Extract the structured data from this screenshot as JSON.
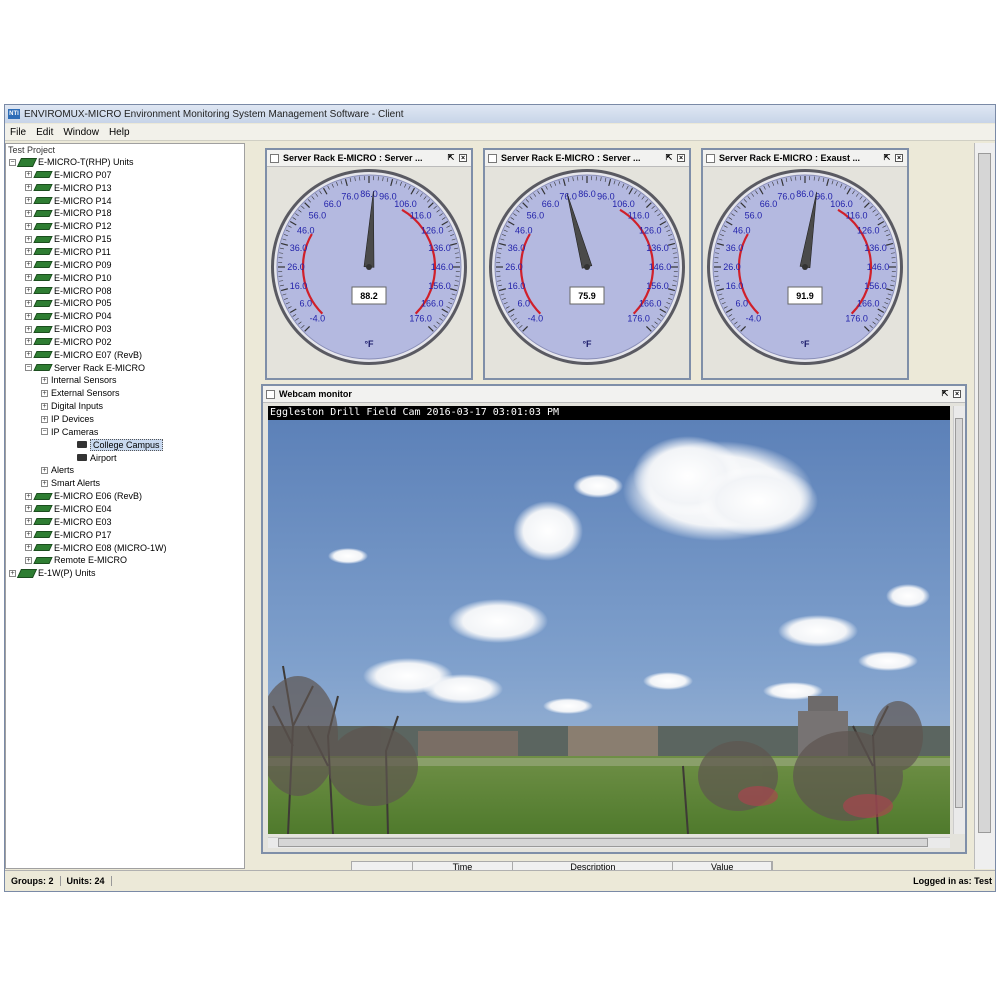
{
  "window": {
    "title": "ENVIROMUX-MICRO Environment Monitoring System Management Software - Client",
    "icon": "nti-logo-icon"
  },
  "menu": [
    "File",
    "Edit",
    "Window",
    "Help"
  ],
  "tree": {
    "root": "Test Project",
    "group1": "E-MICRO-T(RHP) Units",
    "units_a": [
      "E-MICRO P07",
      "E-MICRO P13",
      "E-MICRO P14",
      "E-MICRO P18",
      "E-MICRO P12",
      "E-MICRO P15",
      "E-MICRO P11",
      "E-MICRO P09",
      "E-MICRO P10",
      "E-MICRO P08",
      "E-MICRO P05",
      "E-MICRO P04",
      "E-MICRO P03",
      "E-MICRO P02",
      "E-MICRO E07 (RevB)"
    ],
    "server_rack": "Server Rack E-MICRO",
    "server_children": [
      "Internal Sensors",
      "External Sensors",
      "Digital Inputs",
      "IP Devices",
      "IP Cameras"
    ],
    "cameras": [
      "College Campus",
      "Airport"
    ],
    "selected_camera": "College Campus",
    "server_children_after": [
      "Alerts",
      "Smart Alerts"
    ],
    "units_b": [
      "E-MICRO E06 (RevB)",
      "E-MICRO E04",
      "E-MICRO E03",
      "E-MICRO P17",
      "E-MICRO E08 (MICRO-1W)",
      "Remote E-MICRO"
    ],
    "group2": "E-1W(P) Units"
  },
  "gauges": [
    {
      "title": "Server Rack E-MICRO : Server ...",
      "value": 88.2,
      "display": "88.2",
      "unit": "°F"
    },
    {
      "title": "Server Rack E-MICRO : Server ...",
      "value": 75.9,
      "display": "75.9",
      "unit": "°F"
    },
    {
      "title": "Server Rack E-MICRO : Exaust ...",
      "value": 91.9,
      "display": "91.9",
      "unit": "°F"
    }
  ],
  "gauge_scale": {
    "min": -4.0,
    "max": 176.0,
    "labels": [
      "-4.0",
      "6.0",
      "16.0",
      "26.0",
      "36.0",
      "46.0",
      "56.0",
      "66.0",
      "76.0",
      "86.0",
      "96.0",
      "106.0",
      "116.0",
      "126.0",
      "136.0",
      "146.0",
      "156.0",
      "166.0",
      "176.0"
    ],
    "red_low": [
      -4.0,
      46.0
    ],
    "red_high": [
      106.0,
      176.0
    ],
    "dial_color": "#b4b9e0",
    "label_color": "#2222aa",
    "red_color": "#d0202a"
  },
  "webcam": {
    "title": "Webcam monitor",
    "overlay": "Eggleston Drill Field Cam 2016-03-17 03:01:03 PM"
  },
  "event_table": {
    "columns": [
      "",
      "Time",
      "Description",
      "Value"
    ]
  },
  "status": {
    "groups": "Groups: 2",
    "units": "Units: 24",
    "login": "Logged in as: Test"
  }
}
